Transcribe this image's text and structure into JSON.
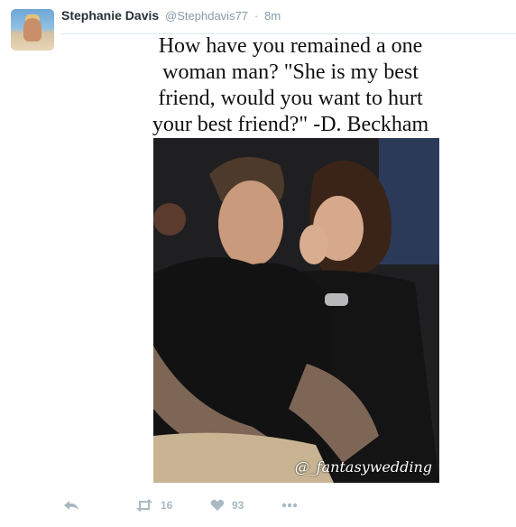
{
  "tweet": {
    "author_name": "Stephanie Davis",
    "author_handle": "@Stephdavis77",
    "separator": "·",
    "time": "8m",
    "avatar_icon": "profile-photo"
  },
  "media": {
    "quote_lines": [
      "How have you remained a one",
      "woman man? \"She is my best",
      "friend, would you want to hurt",
      "your best friend?\" -D. Beckham"
    ],
    "watermark": "@_fantasywedding"
  },
  "actions": {
    "reply_icon": "reply-icon",
    "retweet_icon": "retweet-icon",
    "retweet_count": "16",
    "like_icon": "heart-icon",
    "like_count": "93",
    "more_icon": "more-icon"
  },
  "colors": {
    "name": "#292f33",
    "meta": "#8899a6",
    "action": "#aab8c2"
  }
}
